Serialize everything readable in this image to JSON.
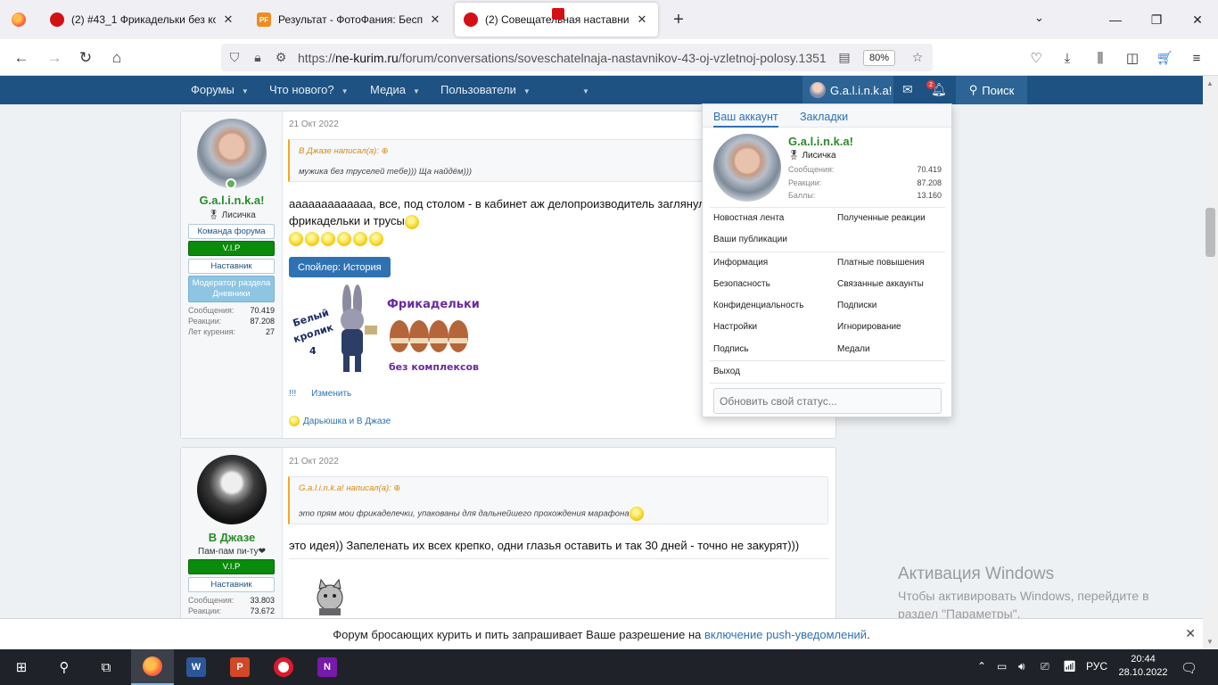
{
  "browser": {
    "tabs": [
      {
        "title": "(2) #43_1 Фрикадельки без ком",
        "favicon": "red-chat-icon"
      },
      {
        "title": "Результат - ФотоФания: Беспл",
        "favicon": "photofunia-icon"
      },
      {
        "title": "(2) Совещательная наставнико",
        "favicon": "red-chat-icon"
      }
    ],
    "url_prefix": "https://",
    "url_host": "ne-kurim.ru",
    "url_path": "/forum/conversations/soveschatelnaja-nastavnikov-43-oj-vzletnoj-polosy.1351",
    "zoom": "80%"
  },
  "forum_nav": {
    "items": [
      "Форумы",
      "Что нового?",
      "Медиа",
      "Пользователи"
    ],
    "account_name": "G.a.l.i.n.k.a!",
    "alerts_count": "2",
    "search_label": "Поиск"
  },
  "messages": [
    {
      "user": {
        "name": "G.a.l.i.n.k.a!",
        "title": "🎖 Лисичка",
        "banners": [
          "Команда форума",
          "V.I.P",
          "Наставник",
          "Модератор раздела Дневники"
        ],
        "stats": [
          {
            "label": "Сообщения:",
            "value": "70.419"
          },
          {
            "label": "Реакции:",
            "value": "87.208"
          },
          {
            "label": "Лет курения:",
            "value": "27"
          }
        ]
      },
      "date": "21 Окт 2022",
      "quote_author": "В Джазе написал(а):",
      "quote_text": "мужика без труселей тебе))) Ща найдём)))",
      "line1": "ааааааааааааа, все, под столом - в кабинет аж делопроизводитель заглянул",
      "line2": "фрикадельки и трусы",
      "spoiler_label": "Спойлер: История",
      "actions": [
        "!!!",
        "Изменить"
      ],
      "reactions": "Дарьюшка и В Джазе"
    },
    {
      "user": {
        "name": "В Джазе",
        "title": "Пам-пам пи-ту❤",
        "banners": [
          "V.I.P",
          "Наставник"
        ],
        "stats": [
          {
            "label": "Сообщения:",
            "value": "33.803"
          },
          {
            "label": "Реакции:",
            "value": "73.672"
          }
        ]
      },
      "date": "21 Окт 2022",
      "quote_author": "G.a.l.i.n.k.a! написал(а):",
      "quote_text": "это прям мои фрикаделечки, упакованы для дальнейшего прохождения марафона",
      "text": "это идея)) Запеленать их всех крепко, одни глазья оставить и так 30 дней - точно не закурят)))"
    }
  ],
  "dropdown": {
    "tabs": [
      "Ваш аккаунт",
      "Закладки"
    ],
    "name": "G.a.l.i.n.k.a!",
    "title": "🎖 Лисичка",
    "stats": [
      {
        "label": "Сообщения:",
        "value": "70.419"
      },
      {
        "label": "Реакции:",
        "value": "87.208"
      },
      {
        "label": "Баллы:",
        "value": "13.160"
      }
    ],
    "links_a": [
      "Новостная лента",
      "Полученные реакции",
      "Ваши публикации"
    ],
    "links_b": [
      "Информация",
      "Платные повышения",
      "Безопасность",
      "Связанные аккаунты",
      "Конфиденциальность",
      "Подписки",
      "Настройки",
      "Игнорирование",
      "Подпись",
      "Медали"
    ],
    "logout": "Выход",
    "status_placeholder": "Обновить свой статус..."
  },
  "activation": {
    "title": "Активация Windows",
    "line1": "Чтобы активировать Windows, перейдите в",
    "line2": "раздел \"Параметры\"."
  },
  "push": {
    "text": "Форум бросающих курить и пить запрашивает Ваше разрешение на",
    "link": "включение push-уведомлений",
    "end": "."
  },
  "taskbar": {
    "lang": "РУС",
    "time": "20:44",
    "date": "28.10.2022"
  }
}
